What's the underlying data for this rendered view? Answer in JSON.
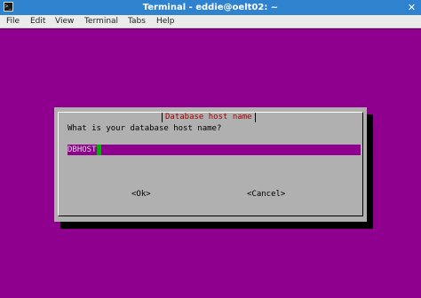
{
  "window": {
    "title": "Terminal - eddie@oelt02: ~",
    "app_icon_glyph": ">_",
    "close_glyph": "✕"
  },
  "menu": {
    "items": [
      "File",
      "Edit",
      "View",
      "Terminal",
      "Tabs",
      "Help"
    ]
  },
  "dialog": {
    "title": "Database host name",
    "question": "What is your database host name?",
    "input_value": "DBHOST",
    "ok_label": "<Ok>",
    "cancel_label": "<Cancel>"
  },
  "colors": {
    "terminal_background": "#8f008f",
    "dialog_background": "#b0b0b0",
    "dialog_title": "#a40000",
    "cursor": "#00b000",
    "titlebar": "#2f82ce"
  }
}
